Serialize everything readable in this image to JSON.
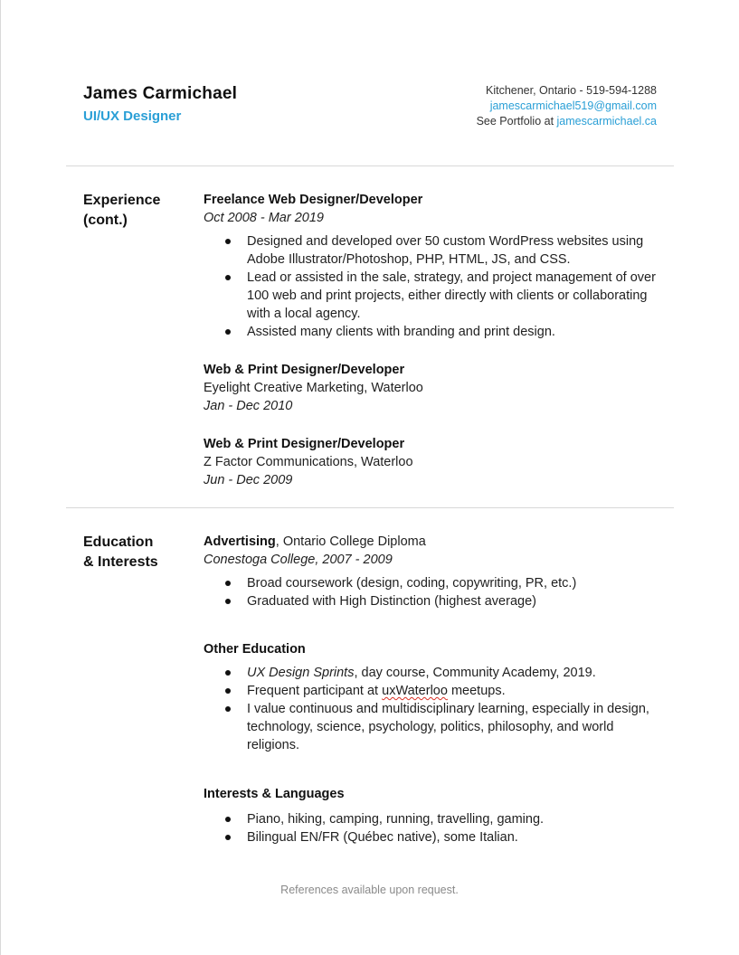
{
  "header": {
    "name": "James Carmichael",
    "title": "UI/UX Designer",
    "location_phone": "Kitchener, Ontario - 519-594-1288",
    "email": "jamescarmichael519@gmail.com",
    "portfolio_prefix": "See Portfolio at ",
    "portfolio_link": "jamescarmichael.ca"
  },
  "colors": {
    "accent": "#2a9fd6",
    "rule": "#d8d8d8",
    "footer": "#8a8a8a"
  },
  "experience": {
    "label_line1": "Experience",
    "label_line2": "(cont.)",
    "jobs": [
      {
        "title": "Freelance Web Designer/Developer",
        "dates": "Oct 2008 - Mar 2019",
        "bullets": [
          "Designed and developed over 50 custom WordPress websites using Adobe Illustrator/Photoshop, PHP, HTML, JS, and CSS.",
          "Lead or assisted in the sale, strategy, and project management of over 100 web and print projects, either directly with clients or collaborating with a local agency.",
          "Assisted many clients with branding and print design."
        ]
      },
      {
        "title": "Web & Print Designer/Developer",
        "company": "Eyelight Creative Marketing, Waterloo",
        "dates": "Jan - Dec 2010"
      },
      {
        "title": "Web & Print Designer/Developer",
        "company": "Z Factor Communications, Waterloo",
        "dates": "Jun - Dec 2009"
      }
    ]
  },
  "education": {
    "label_line1": "Education",
    "label_line2": "& Interests",
    "program": "Advertising",
    "program_suffix": ", Ontario College Diploma",
    "school": "Conestoga College, 2007 - 2009",
    "bullets": [
      "Broad coursework (design, coding, copywriting, PR, etc.)",
      "Graduated with High Distinction (highest average)"
    ],
    "other_heading": "Other Education",
    "other_1_italic": "UX Design Sprints",
    "other_1_rest": ", day course, Community Academy, 2019.",
    "other_2_pre": "Frequent participant at ",
    "other_2_marked": "uxWaterloo",
    "other_2_post": " meetups.",
    "other_3": "I value continuous and multidisciplinary learning, especially in design, technology, science, psychology, politics, philosophy, and world religions.",
    "interests_heading": "Interests & Languages",
    "interests": [
      "Piano, hiking, camping, running, travelling, gaming.",
      "Bilingual EN/FR (Québec native), some Italian."
    ]
  },
  "footer": {
    "text": "References available upon request."
  }
}
